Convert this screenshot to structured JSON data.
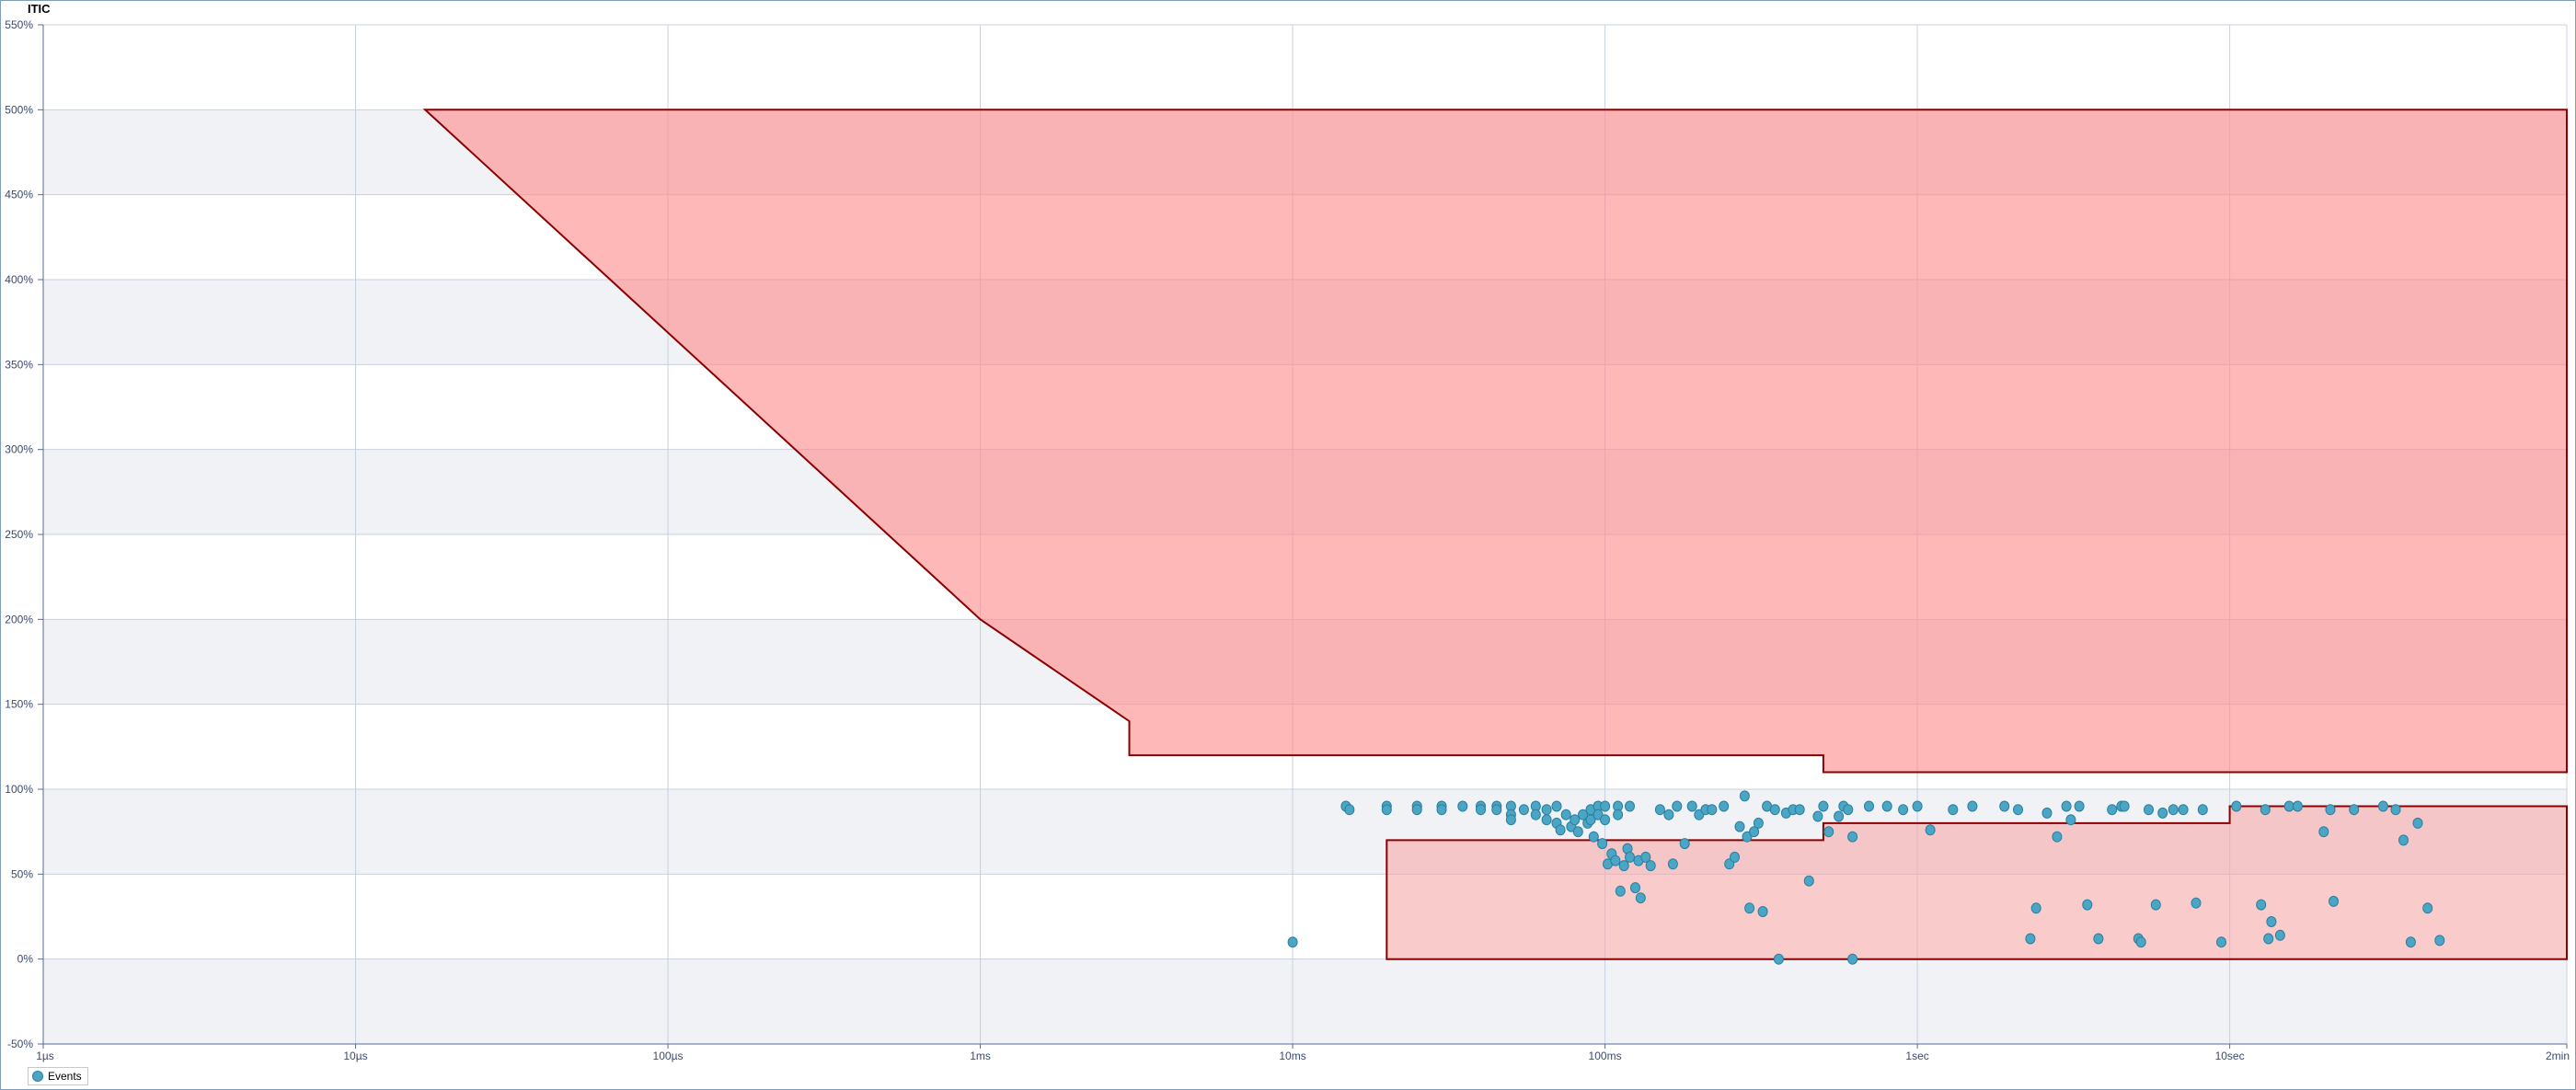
{
  "chart_data": {
    "type": "scatter",
    "title": "ITIC",
    "xlabel": "",
    "ylabel": "",
    "x_scale": "log",
    "x_unit": "seconds",
    "x_ticks": [
      {
        "value": 1e-06,
        "label": "1µs"
      },
      {
        "value": 1e-05,
        "label": "10µs"
      },
      {
        "value": 0.0001,
        "label": "100µs"
      },
      {
        "value": 0.001,
        "label": "1ms"
      },
      {
        "value": 0.01,
        "label": "10ms"
      },
      {
        "value": 0.1,
        "label": "100ms"
      },
      {
        "value": 1,
        "label": "1sec"
      },
      {
        "value": 10,
        "label": "10sec"
      },
      {
        "value": 120,
        "label": "2min"
      }
    ],
    "xlim": [
      1e-06,
      120
    ],
    "y_ticks": [
      -50,
      0,
      50,
      100,
      150,
      200,
      250,
      300,
      350,
      400,
      450,
      500,
      550
    ],
    "y_tick_suffix": "%",
    "ylim": [
      -50,
      550
    ],
    "grid": true,
    "alternating_bands": true,
    "legend_position": "bottom-left",
    "colors": {
      "prohibited_fill": "#ff8c8c",
      "no_damage_fill": "#f7a8a8",
      "boundary_line": "#8b0000",
      "points": "#4aa6c4",
      "point_edge": "#2a7f9f",
      "grid": "#c8d0e0",
      "band": "#f0f2f6",
      "axis_text": "#3a4a70"
    },
    "regions": [
      {
        "name": "prohibited",
        "polygon": [
          [
            1.67e-05,
            500
          ],
          [
            0.001,
            200
          ],
          [
            0.003,
            140
          ],
          [
            0.003,
            120
          ],
          [
            0.5,
            120
          ],
          [
            0.5,
            110
          ],
          [
            120,
            110
          ],
          [
            120,
            500
          ]
        ]
      },
      {
        "name": "no_damage",
        "polygon": [
          [
            0.02,
            0
          ],
          [
            0.02,
            70
          ],
          [
            0.5,
            70
          ],
          [
            0.5,
            80
          ],
          [
            10,
            80
          ],
          [
            10,
            90
          ],
          [
            120,
            90
          ],
          [
            120,
            0
          ]
        ]
      }
    ],
    "series": [
      {
        "name": "Events",
        "points": [
          [
            0.01,
            10
          ],
          [
            0.0148,
            90
          ],
          [
            0.0152,
            88
          ],
          [
            0.02,
            90
          ],
          [
            0.02,
            88
          ],
          [
            0.025,
            90
          ],
          [
            0.025,
            88
          ],
          [
            0.03,
            90
          ],
          [
            0.03,
            88
          ],
          [
            0.035,
            90
          ],
          [
            0.04,
            90
          ],
          [
            0.04,
            88
          ],
          [
            0.045,
            90
          ],
          [
            0.045,
            88
          ],
          [
            0.05,
            90
          ],
          [
            0.05,
            85
          ],
          [
            0.05,
            82
          ],
          [
            0.055,
            88
          ],
          [
            0.06,
            90
          ],
          [
            0.06,
            85
          ],
          [
            0.065,
            88
          ],
          [
            0.065,
            82
          ],
          [
            0.07,
            90
          ],
          [
            0.07,
            80
          ],
          [
            0.072,
            76
          ],
          [
            0.075,
            85
          ],
          [
            0.078,
            78
          ],
          [
            0.08,
            82
          ],
          [
            0.082,
            75
          ],
          [
            0.085,
            85
          ],
          [
            0.088,
            80
          ],
          [
            0.09,
            88
          ],
          [
            0.09,
            82
          ],
          [
            0.092,
            72
          ],
          [
            0.095,
            90
          ],
          [
            0.095,
            85
          ],
          [
            0.098,
            68
          ],
          [
            0.1,
            90
          ],
          [
            0.1,
            82
          ],
          [
            0.102,
            56
          ],
          [
            0.105,
            62
          ],
          [
            0.108,
            58
          ],
          [
            0.11,
            90
          ],
          [
            0.11,
            85
          ],
          [
            0.112,
            40
          ],
          [
            0.115,
            55
          ],
          [
            0.118,
            65
          ],
          [
            0.12,
            90
          ],
          [
            0.12,
            60
          ],
          [
            0.125,
            42
          ],
          [
            0.128,
            58
          ],
          [
            0.13,
            36
          ],
          [
            0.135,
            60
          ],
          [
            0.14,
            55
          ],
          [
            0.15,
            88
          ],
          [
            0.16,
            85
          ],
          [
            0.165,
            56
          ],
          [
            0.17,
            90
          ],
          [
            0.18,
            68
          ],
          [
            0.19,
            90
          ],
          [
            0.2,
            85
          ],
          [
            0.21,
            88
          ],
          [
            0.22,
            88
          ],
          [
            0.24,
            90
          ],
          [
            0.25,
            56
          ],
          [
            0.26,
            60
          ],
          [
            0.27,
            78
          ],
          [
            0.28,
            96
          ],
          [
            0.285,
            72
          ],
          [
            0.29,
            30
          ],
          [
            0.3,
            75
          ],
          [
            0.31,
            80
          ],
          [
            0.32,
            28
          ],
          [
            0.33,
            90
          ],
          [
            0.35,
            88
          ],
          [
            0.36,
            0
          ],
          [
            0.38,
            86
          ],
          [
            0.4,
            88
          ],
          [
            0.42,
            88
          ],
          [
            0.45,
            46
          ],
          [
            0.48,
            84
          ],
          [
            0.5,
            90
          ],
          [
            0.52,
            75
          ],
          [
            0.56,
            84
          ],
          [
            0.58,
            90
          ],
          [
            0.6,
            88
          ],
          [
            0.62,
            0
          ],
          [
            0.62,
            72
          ],
          [
            0.7,
            90
          ],
          [
            0.8,
            90
          ],
          [
            0.9,
            88
          ],
          [
            1.0,
            90
          ],
          [
            1.1,
            76
          ],
          [
            1.3,
            88
          ],
          [
            1.5,
            90
          ],
          [
            1.9,
            90
          ],
          [
            2.1,
            88
          ],
          [
            2.3,
            12
          ],
          [
            2.4,
            30
          ],
          [
            2.6,
            86
          ],
          [
            2.8,
            72
          ],
          [
            3.0,
            90
          ],
          [
            3.1,
            82
          ],
          [
            3.3,
            90
          ],
          [
            3.5,
            32
          ],
          [
            3.8,
            12
          ],
          [
            4.2,
            88
          ],
          [
            4.5,
            90
          ],
          [
            4.6,
            90
          ],
          [
            5.1,
            12
          ],
          [
            5.2,
            10
          ],
          [
            5.5,
            88
          ],
          [
            5.8,
            32
          ],
          [
            6.1,
            86
          ],
          [
            6.6,
            88
          ],
          [
            7.1,
            88
          ],
          [
            7.8,
            33
          ],
          [
            8.2,
            88
          ],
          [
            9.4,
            10
          ],
          [
            10.5,
            90
          ],
          [
            12.6,
            32
          ],
          [
            13,
            88
          ],
          [
            13.3,
            12
          ],
          [
            13.6,
            22
          ],
          [
            14.5,
            14
          ],
          [
            15.5,
            90
          ],
          [
            16.5,
            90
          ],
          [
            20,
            75
          ],
          [
            21,
            88
          ],
          [
            21.5,
            34
          ],
          [
            25,
            88
          ],
          [
            31,
            90
          ],
          [
            34,
            88
          ],
          [
            36,
            70
          ],
          [
            38,
            10
          ],
          [
            40,
            80
          ],
          [
            43,
            30
          ],
          [
            47,
            11
          ]
        ]
      }
    ]
  }
}
